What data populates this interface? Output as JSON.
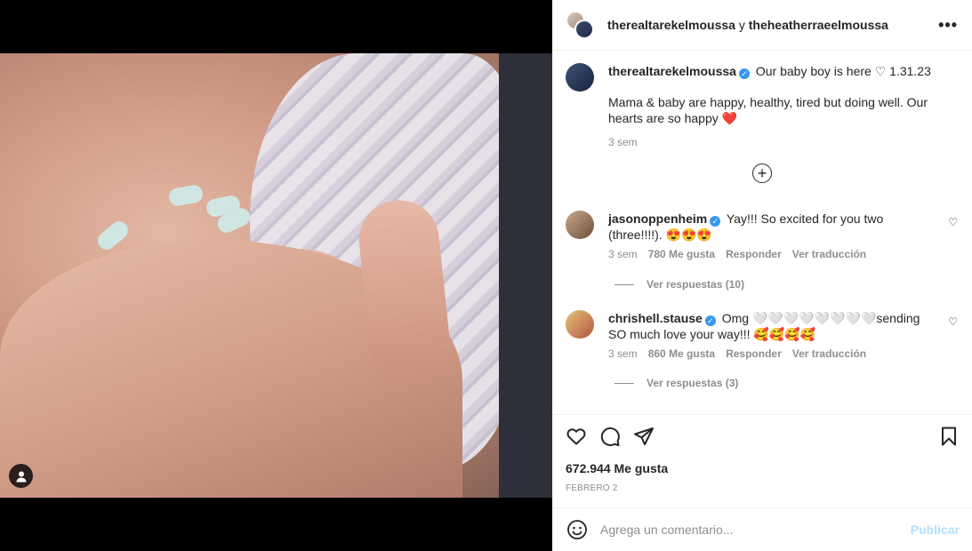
{
  "header": {
    "user1": "therealtarekelmoussa",
    "separator": "y",
    "user2": "theheatherraeelmoussa",
    "more_label": "•••"
  },
  "caption": {
    "username": "therealtarekelmoussa",
    "title": "Our baby boy is here",
    "heart": "♡",
    "date_text": "1.31.23",
    "body": "Mama & baby are happy, healthy, tired but doing well. Our hearts are so happy",
    "body_emoji": "❤️",
    "age": "3 sem"
  },
  "load_more_icon": "plus-circle-icon",
  "comments": [
    {
      "username": "jasonoppenheim",
      "text": "Yay!!! So excited for you two (three!!!!). 😍😍😍",
      "age": "3 sem",
      "likes": "780 Me gusta",
      "reply": "Responder",
      "translate": "Ver traducción",
      "replies": "Ver respuestas (10)"
    },
    {
      "username": "chrishell.stause",
      "text": "Omg 🤍🤍🤍🤍🤍🤍🤍🤍sending SO much love your way!!! 🥰🥰🥰🥰",
      "age": "3 sem",
      "likes": "860 Me gusta",
      "reply": "Responder",
      "translate": "Ver traducción",
      "replies": "Ver respuestas (3)"
    }
  ],
  "actions": {
    "likes": "672.944 Me gusta",
    "date": "FEBRERO 2"
  },
  "add_comment": {
    "placeholder": "Agrega un comentario...",
    "publish": "Publicar"
  },
  "colors": {
    "verified": "#3897f0",
    "publish_disabled": "#b2dffc",
    "muted": "#8e8e8e"
  }
}
